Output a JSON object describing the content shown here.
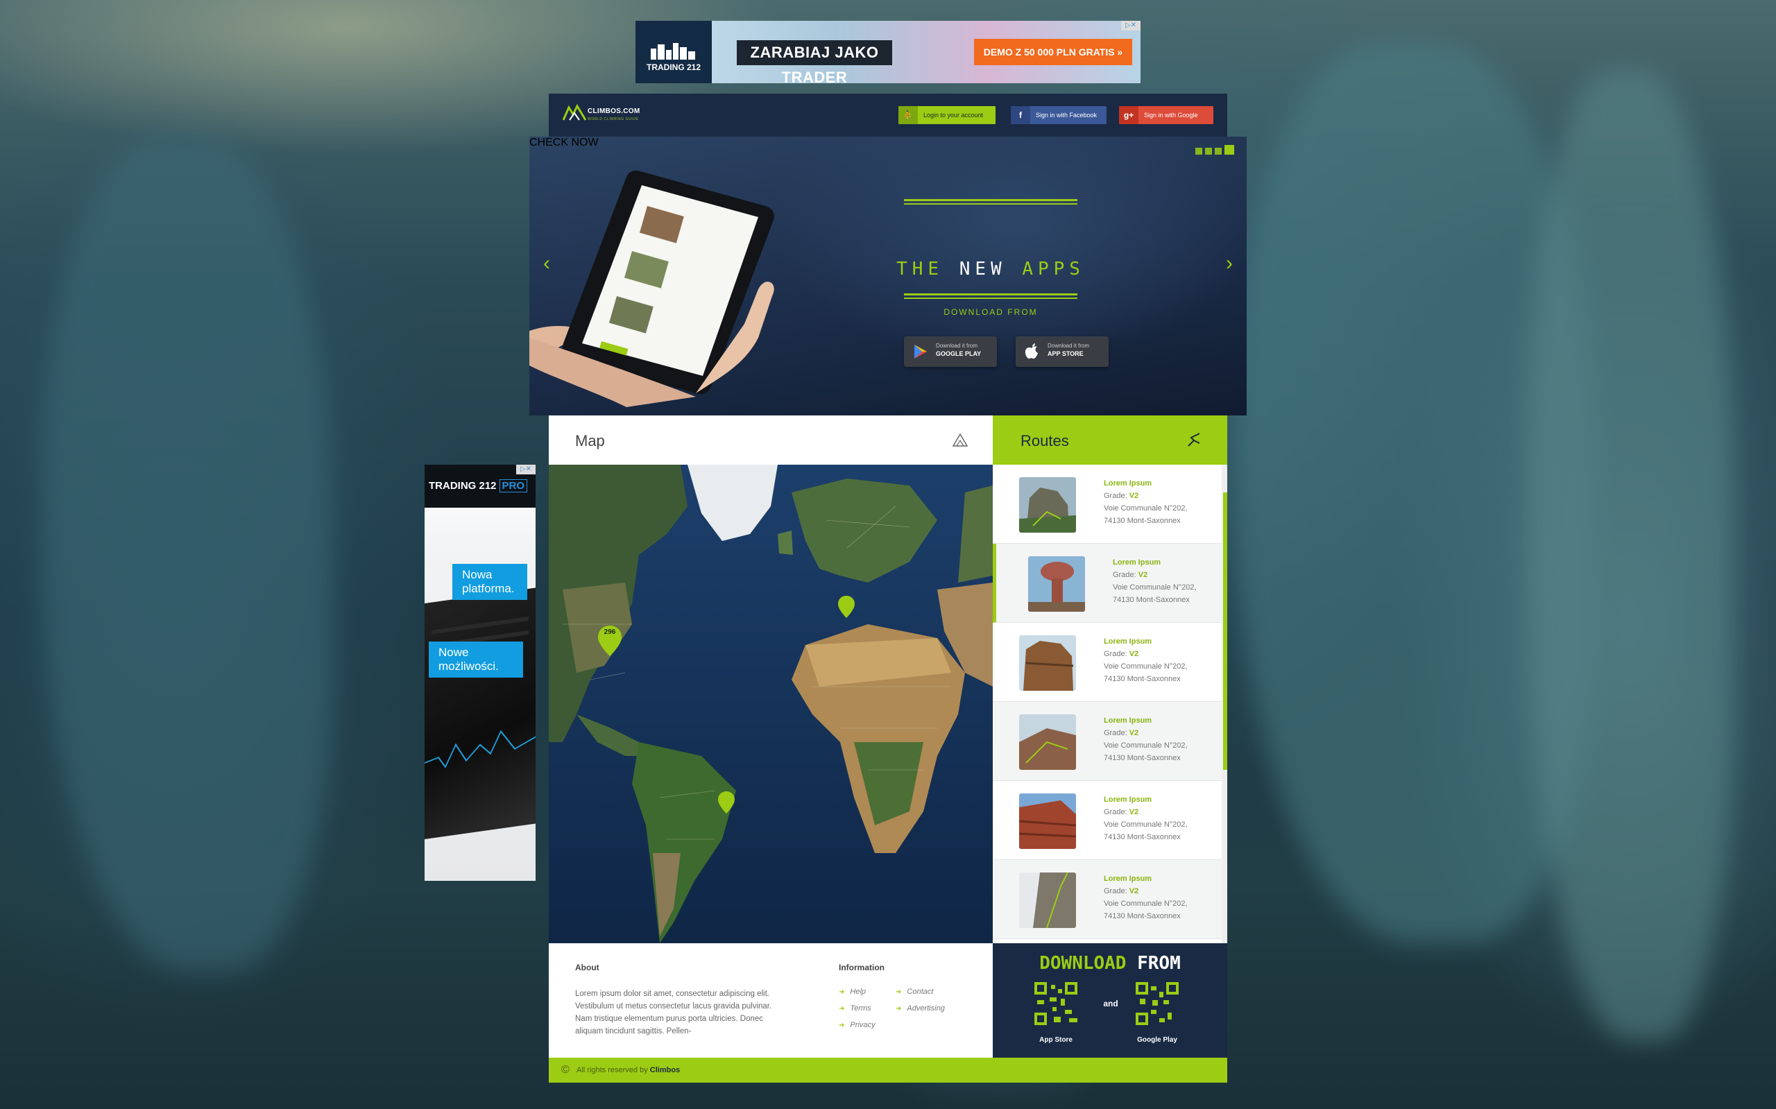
{
  "top_ad": {
    "brand": "TRADING 212",
    "headline": "ZARABIAJ JAKO TRADER",
    "cta": "DEMO Z 50 000 PLN GRATIS »"
  },
  "side_ad": {
    "brand": "TRADING 212",
    "brand_suffix": "PRO",
    "bubble_1": "Nowa platforma.",
    "bubble_2": "Nowe możliwości."
  },
  "header": {
    "logo_title": "CLIMBOS.COM",
    "logo_tagline": "WORLD CLIMBING GUIDE",
    "login_label": "Login to your account",
    "facebook_label": "Sign in with Facebook",
    "google_label": "Sign in with Google"
  },
  "hero": {
    "headline": "CHECK NOW",
    "subline_1": "THE",
    "subline_2": "NEW",
    "subline_3": "APPS",
    "download_from": "DOWNLOAD FROM",
    "google_play_small": "Download it from",
    "google_play_big": "GOOGLE PLAY",
    "app_store_small": "Download it from",
    "app_store_big": "APP STORE"
  },
  "map": {
    "title": "Map",
    "cluster_count": "296"
  },
  "routes": {
    "title": "Routes",
    "items": [
      {
        "name": "Lorem Ipsum",
        "grade_label": "Grade:",
        "grade": "V2",
        "address_1": "Voie Communale N°202,",
        "address_2": "74130 Mont-Saxonnex"
      },
      {
        "name": "Lorem Ipsum",
        "grade_label": "Grade:",
        "grade": "V2",
        "address_1": "Voie Communale N°202,",
        "address_2": "74130 Mont-Saxonnex"
      },
      {
        "name": "Lorem Ipsum",
        "grade_label": "Grade:",
        "grade": "V2",
        "address_1": "Voie Communale N°202,",
        "address_2": "74130 Mont-Saxonnex"
      },
      {
        "name": "Lorem Ipsum",
        "grade_label": "Grade:",
        "grade": "V2",
        "address_1": "Voie Communale N°202,",
        "address_2": "74130 Mont-Saxonnex"
      },
      {
        "name": "Lorem Ipsum",
        "grade_label": "Grade:",
        "grade": "V2",
        "address_1": "Voie Communale N°202,",
        "address_2": "74130 Mont-Saxonnex"
      },
      {
        "name": "Lorem Ipsum",
        "grade_label": "Grade:",
        "grade": "V2",
        "address_1": "Voie Communale N°202,",
        "address_2": "74130 Mont-Saxonnex"
      }
    ]
  },
  "footer": {
    "about_heading": "About",
    "about_text": "Lorem ipsum dolor sit amet, consectetur adipiscing elit. Vestibulum ut metus consectetur lacus gravida pulvinar. Nam tristique elementum purus porta ultricies. Donec aliquam tincidunt sagittis. Pellen-",
    "info_heading": "Information",
    "links": {
      "help": "Help",
      "terms": "Terms",
      "privacy": "Privacy",
      "contact": "Contact",
      "advertising": "Advertising"
    }
  },
  "download_panel": {
    "title_1": "DOWNLOAD",
    "title_2": "FROM",
    "and": "and",
    "app_store": "App Store",
    "google_play": "Google Play"
  },
  "copyright": {
    "text": "All rights reserved by",
    "brand": "Climbos",
    "symbol": "©"
  },
  "colors": {
    "accent": "#9ccc14",
    "navy": "#1a2a44",
    "facebook": "#3b5998",
    "google": "#dd4b39"
  }
}
